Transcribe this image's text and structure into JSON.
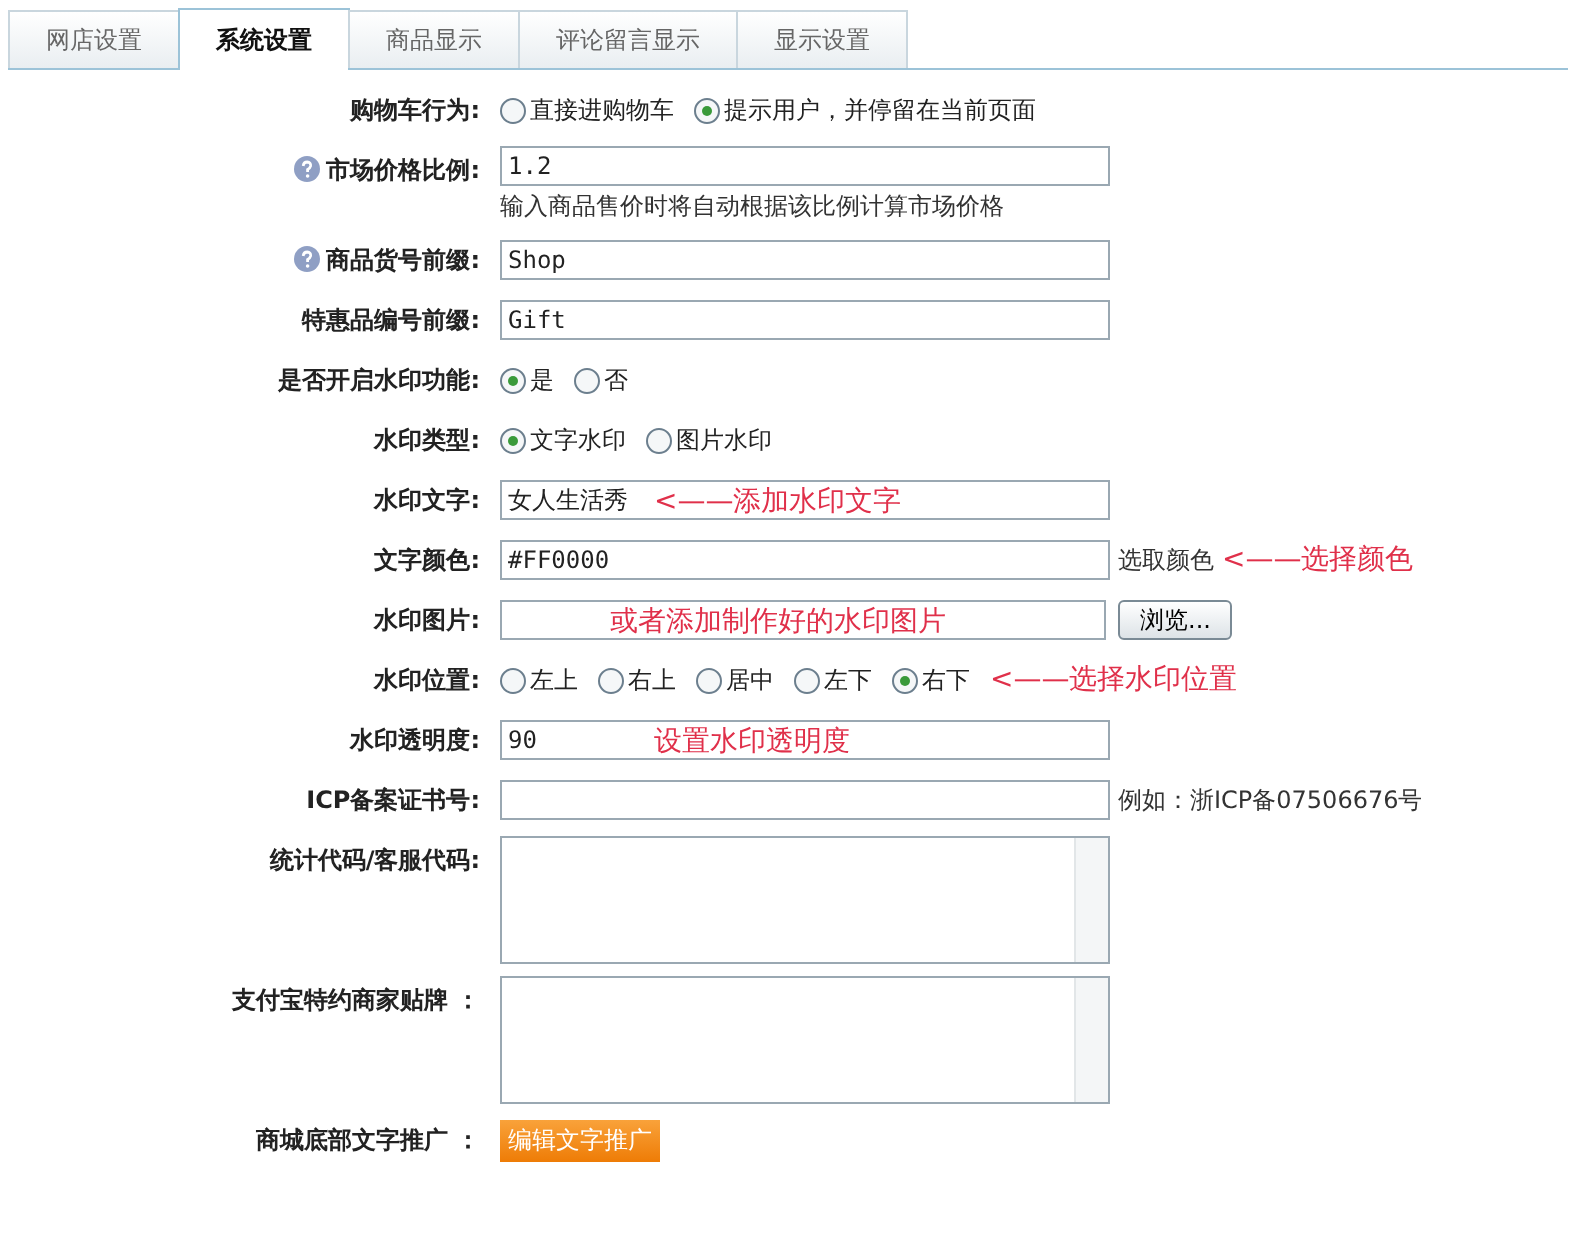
{
  "tabs": [
    {
      "label": "网店设置",
      "selected": false
    },
    {
      "label": "系统设置",
      "selected": true
    },
    {
      "label": "商品显示",
      "selected": false
    },
    {
      "label": "评论留言显示",
      "selected": false
    },
    {
      "label": "显示设置",
      "selected": false
    }
  ],
  "rows": [
    {
      "kind": "radio",
      "label": "购物车行为:",
      "options": [
        {
          "label": "直接进购物车",
          "selected": false
        },
        {
          "label": "提示用户，并停留在当前页面",
          "selected": true
        }
      ]
    },
    {
      "kind": "text",
      "label": "市场价格比例:",
      "help": true,
      "value": "1.2",
      "hint": "输入商品售价时将自动根据该比例计算市场价格"
    },
    {
      "kind": "text",
      "label": "商品货号前缀:",
      "help": true,
      "value": "Shop"
    },
    {
      "kind": "text",
      "label": "特惠品编号前缀:",
      "value": "Gift"
    },
    {
      "kind": "radio",
      "label": "是否开启水印功能:",
      "options": [
        {
          "label": "是",
          "selected": true
        },
        {
          "label": "否",
          "selected": false
        }
      ]
    },
    {
      "kind": "radio",
      "label": "水印类型:",
      "options": [
        {
          "label": "文字水印",
          "selected": true
        },
        {
          "label": "图片水印",
          "selected": false
        }
      ]
    },
    {
      "kind": "text",
      "label": "水印文字:",
      "value": "女人生活秀",
      "annotation": "<——添加水印文字"
    },
    {
      "kind": "text",
      "label": "文字颜色:",
      "value": "#FF0000",
      "suffix": "选取颜色",
      "annotation": "<——选择颜色"
    },
    {
      "kind": "file",
      "label": "水印图片:",
      "annotation": "或者添加制作好的水印图片",
      "button": "浏览..."
    },
    {
      "kind": "radio",
      "label": "水印位置:",
      "options": [
        {
          "label": "左上",
          "selected": false
        },
        {
          "label": "右上",
          "selected": false
        },
        {
          "label": "居中",
          "selected": false
        },
        {
          "label": "左下",
          "selected": false
        },
        {
          "label": "右下",
          "selected": true
        }
      ],
      "annotation": "<——选择水印位置"
    },
    {
      "kind": "text",
      "label": "水印透明度:",
      "value": "90",
      "annotation": "设置水印透明度"
    },
    {
      "kind": "text",
      "label": "ICP备案证书号:",
      "suffix": "例如：浙ICP备07506676号"
    },
    {
      "kind": "textarea",
      "label": "统计代码/客服代码:"
    },
    {
      "kind": "textarea",
      "label": "支付宝特约商家贴牌 ："
    },
    {
      "kind": "action",
      "label": "商城底部文字推广 ：",
      "button": "编辑文字推广"
    }
  ]
}
